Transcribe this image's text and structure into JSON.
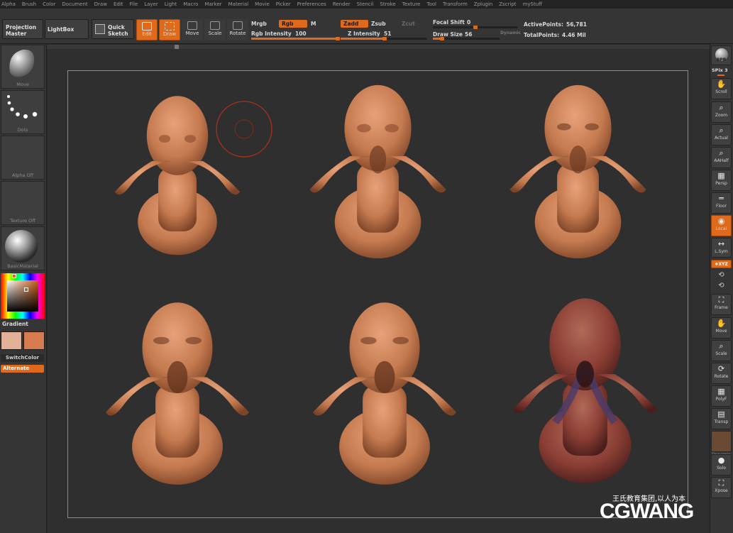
{
  "menu": [
    "Alpha",
    "Brush",
    "Color",
    "Document",
    "Draw",
    "Edit",
    "File",
    "Layer",
    "Light",
    "Macro",
    "Marker",
    "Material",
    "Movie",
    "Picker",
    "Preferences",
    "Render",
    "Stencil",
    "Stroke",
    "Texture",
    "Tool",
    "Transform",
    "Zplugin",
    "Zscript",
    "myStuff"
  ],
  "toolbar": {
    "projection_master": "Projection Master",
    "lightbox": "LightBox",
    "quick_sketch": "Quick Sketch",
    "edit": "Edit",
    "draw": "Draw",
    "move": "Move",
    "scale": "Scale",
    "rotate": "Rotate",
    "mrgb": "Mrgb",
    "rgb": "Rgb",
    "m": "M",
    "rgb_intensity_label": "Rgb  Intensity",
    "rgb_intensity_value": "100",
    "zadd": "Zadd",
    "zsub": "Zsub",
    "zcut": "Zcut",
    "z_intensity_label": "Z  Intensity",
    "z_intensity_value": "51",
    "focal_shift_label": "Focal  Shift",
    "focal_shift_value": "0",
    "draw_size_label": "Draw  Size",
    "draw_size_value": "56",
    "dynamic": "Dynamic",
    "active_points_label": "ActivePoints:",
    "active_points_value": "56,781",
    "total_points_label": "TotalPoints:",
    "total_points_value": "4.46  Mil"
  },
  "levels": {
    "rgb_intensity": 100,
    "z_intensity": 51,
    "focal_shift": 0,
    "draw_size": 56
  },
  "leftbar": {
    "brush": "Move",
    "stroke": "Dots",
    "alpha": "Alpha  Off",
    "texture": "Texture  Off",
    "material": "BasicMaterial",
    "gradient": "Gradient",
    "switch_color": "SwitchColor",
    "alternate": "Alternate"
  },
  "colors": {
    "accent": "#e06a1b",
    "clay": "#c98056",
    "primary_swatch": "#e3b09a",
    "secondary_swatch": "#d77a4e"
  },
  "rightbar": {
    "bpr": "BPR",
    "spix_label": "SPix",
    "spix_value": "3",
    "scroll": "Scroll",
    "zoom": "Zoom",
    "actual": "Actual",
    "aahalf": "AAHalf",
    "persp": "Persp",
    "floor": "Floor",
    "local": "Local",
    "lsym": "L.Sym",
    "xyz": "❖XYZ",
    "frame": "Frame",
    "move": "Move",
    "scale": "Scale",
    "rotate": "Rotate",
    "polyf": "PolyF",
    "transp": "Transp",
    "dynamic": "Dynamic",
    "solo": "Solo",
    "xpose": "Xpose"
  },
  "watermark": {
    "chinese": "王氏教育集团,以人为本",
    "brand": "CGWANG"
  }
}
